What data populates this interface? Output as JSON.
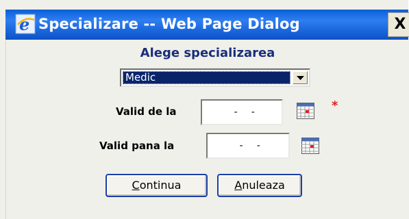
{
  "window": {
    "title": "Specializare -- Web Page Dialog",
    "close_label": "X"
  },
  "form": {
    "heading": "Alege specializarea",
    "specialization": {
      "selected": "Medic"
    },
    "valid_from": {
      "label": "Valid de la",
      "value": "  -  -",
      "required_mark": "*"
    },
    "valid_to": {
      "label": "Valid pana la",
      "value": "  -  -"
    }
  },
  "buttons": {
    "continue": {
      "mnemonic": "C",
      "rest": "ontinua"
    },
    "cancel": {
      "mnemonic": "A",
      "rest": "nuleaza"
    }
  },
  "colors": {
    "titlebar": "#1a66dc",
    "selection": "#0a246a",
    "heading": "#1a2e7a",
    "required": "#e02020",
    "button_border": "#1c3fa8"
  },
  "icons": {
    "app": "ie-icon",
    "calendar": "calendar-icon",
    "dropdown": "chevron-down-icon"
  }
}
